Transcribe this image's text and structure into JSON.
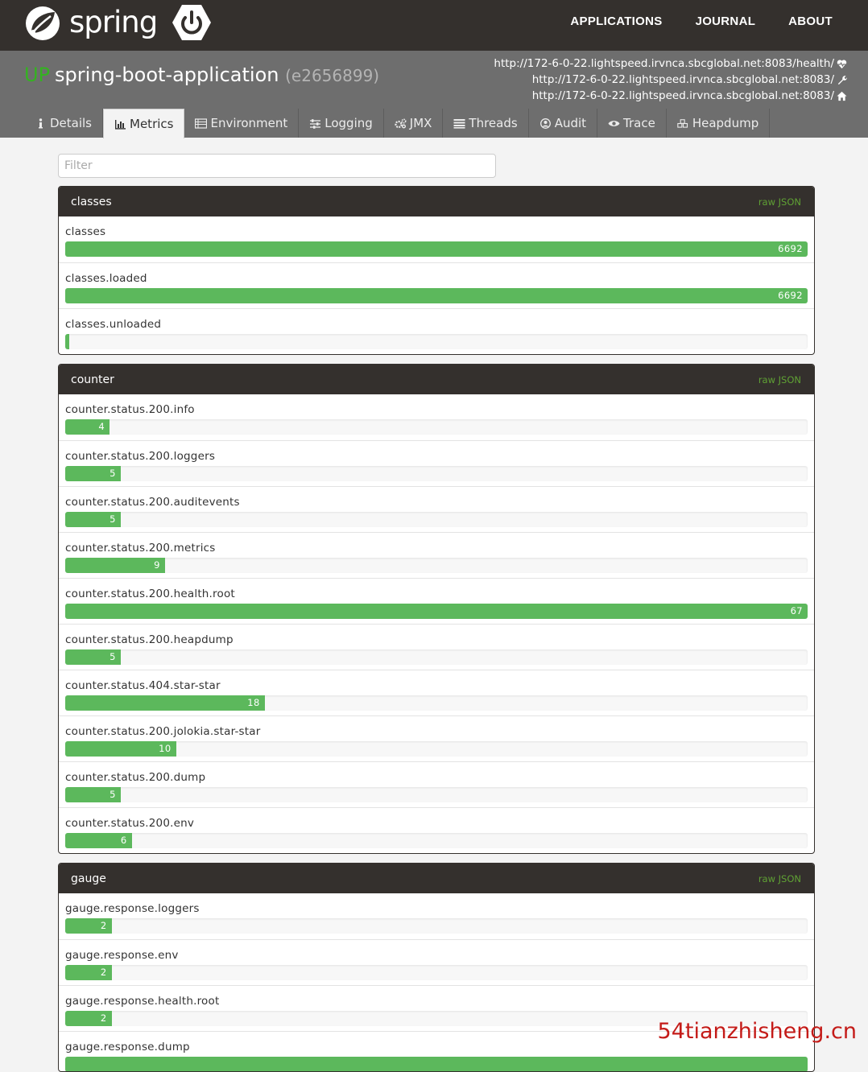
{
  "nav": {
    "brand": "spring",
    "links": [
      "APPLICATIONS",
      "JOURNAL",
      "ABOUT"
    ]
  },
  "app": {
    "status": "UP",
    "name": "spring-boot-application",
    "id": "(e2656899)",
    "urls": [
      {
        "text": "http://172-6-0-22.lightspeed.irvnca.sbcglobal.net:8083/health/",
        "icon": "heartbeat-icon"
      },
      {
        "text": "http://172-6-0-22.lightspeed.irvnca.sbcglobal.net:8083/",
        "icon": "wrench-icon"
      },
      {
        "text": "http://172-6-0-22.lightspeed.irvnca.sbcglobal.net:8083/",
        "icon": "home-icon"
      }
    ]
  },
  "tabs": [
    {
      "label": "Details",
      "icon": "info-icon"
    },
    {
      "label": "Metrics",
      "icon": "bar-chart-icon",
      "active": true
    },
    {
      "label": "Environment",
      "icon": "list-icon"
    },
    {
      "label": "Logging",
      "icon": "sliders-icon"
    },
    {
      "label": "JMX",
      "icon": "cogs-icon"
    },
    {
      "label": "Threads",
      "icon": "align-justify-icon"
    },
    {
      "label": "Audit",
      "icon": "user-circle-icon"
    },
    {
      "label": "Trace",
      "icon": "eye-icon"
    },
    {
      "label": "Heapdump",
      "icon": "cubes-icon"
    }
  ],
  "filter": {
    "placeholder": "Filter",
    "value": ""
  },
  "colors": {
    "navbar": "#34302d",
    "header": "#6e6e6e",
    "up": "#34b320",
    "bar": "#5cb85c",
    "raw_json": "#5fa134"
  },
  "panels": [
    {
      "title": "classes",
      "raw_label": "raw JSON",
      "max": 6692,
      "metrics": [
        {
          "name": "classes",
          "value": 6692
        },
        {
          "name": "classes.loaded",
          "value": 6692
        },
        {
          "name": "classes.unloaded",
          "value": 0
        }
      ]
    },
    {
      "title": "counter",
      "raw_label": "raw JSON",
      "max": 67,
      "metrics": [
        {
          "name": "counter.status.200.info",
          "value": 4
        },
        {
          "name": "counter.status.200.loggers",
          "value": 5
        },
        {
          "name": "counter.status.200.auditevents",
          "value": 5
        },
        {
          "name": "counter.status.200.metrics",
          "value": 9
        },
        {
          "name": "counter.status.200.health.root",
          "value": 67
        },
        {
          "name": "counter.status.200.heapdump",
          "value": 5
        },
        {
          "name": "counter.status.404.star-star",
          "value": 18
        },
        {
          "name": "counter.status.200.jolokia.star-star",
          "value": 10
        },
        {
          "name": "counter.status.200.dump",
          "value": 5
        },
        {
          "name": "counter.status.200.env",
          "value": 6
        }
      ]
    },
    {
      "title": "gauge",
      "raw_label": "raw JSON",
      "max": 32,
      "metrics": [
        {
          "name": "gauge.response.loggers",
          "value": 2
        },
        {
          "name": "gauge.response.env",
          "value": 2
        },
        {
          "name": "gauge.response.health.root",
          "value": 2
        },
        {
          "name": "gauge.response.dump",
          "value": null
        }
      ]
    }
  ],
  "watermark": "54tianzhisheng.cn"
}
